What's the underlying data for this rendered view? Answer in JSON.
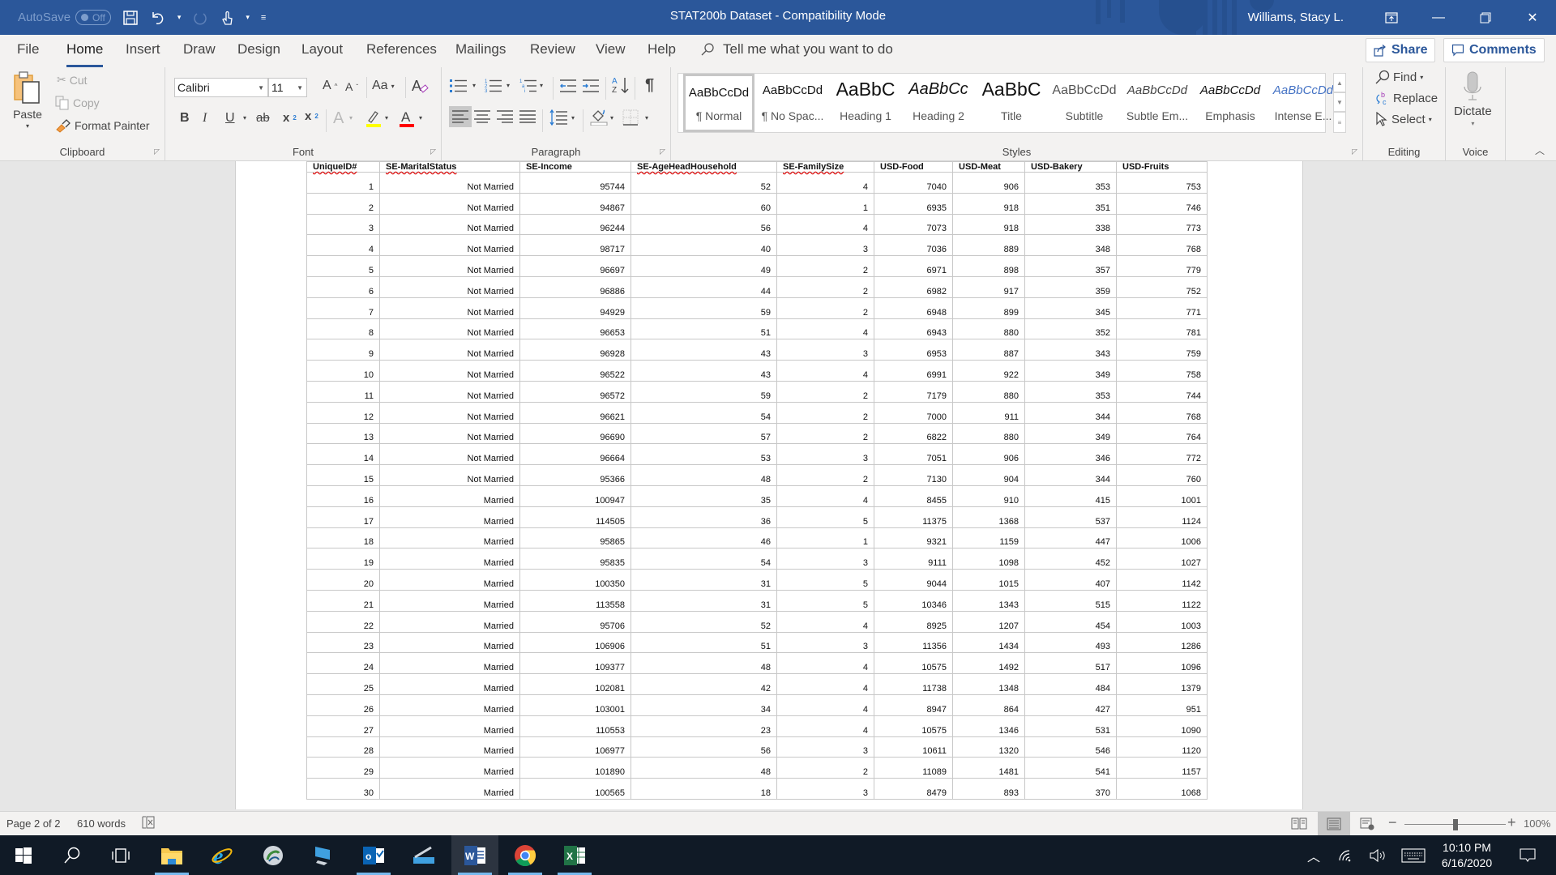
{
  "titlebar": {
    "autosave_label": "AutoSave",
    "autosave_state": "Off",
    "doc_title": "STAT200b Dataset  -  Compatibility Mode",
    "user_name": "Williams, Stacy L.",
    "qat": [
      "save-icon",
      "undo-icon",
      "redo-icon",
      "touch-mode-icon",
      "customize-qat-icon"
    ],
    "window_buttons": [
      "ribbon-display-options-icon",
      "minimize-icon",
      "restore-icon",
      "close-icon"
    ]
  },
  "tabs": [
    {
      "label": "File",
      "active": false
    },
    {
      "label": "Home",
      "active": true
    },
    {
      "label": "Insert",
      "active": false
    },
    {
      "label": "Draw",
      "active": false
    },
    {
      "label": "Design",
      "active": false
    },
    {
      "label": "Layout",
      "active": false
    },
    {
      "label": "References",
      "active": false
    },
    {
      "label": "Mailings",
      "active": false
    },
    {
      "label": "Review",
      "active": false
    },
    {
      "label": "View",
      "active": false
    },
    {
      "label": "Help",
      "active": false
    }
  ],
  "tellme": {
    "placeholder": "Tell me what you want to do"
  },
  "share_label": "Share",
  "comments_label": "Comments",
  "ribbon": {
    "clipboard": {
      "label": "Clipboard",
      "paste": "Paste",
      "cut": "Cut",
      "copy": "Copy",
      "format_painter": "Format Painter"
    },
    "font": {
      "label": "Font",
      "font_name": "Calibri",
      "font_size": "11",
      "change_case": "Aa"
    },
    "paragraph": {
      "label": "Paragraph"
    },
    "styles": {
      "label": "Styles",
      "items": [
        {
          "sample": "AaBbCcDd",
          "name": "¶ Normal",
          "selected": true
        },
        {
          "sample": "AaBbCcDd",
          "name": "¶ No Spac...",
          "selected": false
        },
        {
          "sample": "AaBbC",
          "name": "Heading 1",
          "selected": false
        },
        {
          "sample": "AaBbCc",
          "name": "Heading 2",
          "selected": false
        },
        {
          "sample": "AaBbC",
          "name": "Title",
          "selected": false
        },
        {
          "sample": "AaBbCcDd",
          "name": "Subtitle",
          "selected": false
        },
        {
          "sample": "AaBbCcDd",
          "name": "Subtle Em...",
          "selected": false
        },
        {
          "sample": "AaBbCcDd",
          "name": "Emphasis",
          "selected": false
        },
        {
          "sample": "AaBbCcDd",
          "name": "Intense E...",
          "selected": false
        }
      ]
    },
    "editing": {
      "label": "Editing",
      "find": "Find",
      "replace": "Replace",
      "select": "Select"
    },
    "voice": {
      "label": "Voice",
      "dictate": "Dictate"
    }
  },
  "table": {
    "headers": [
      "UniqueID#",
      "SE-MaritalStatus",
      "SE-Income",
      "SE-AgeHeadHousehold",
      "SE-FamilySize",
      "USD-Food",
      "USD-Meat",
      "USD-Bakery",
      "USD-Fruits"
    ],
    "rows": [
      [
        "1",
        "Not Married",
        "95744",
        "52",
        "4",
        "7040",
        "906",
        "353",
        "753"
      ],
      [
        "2",
        "Not Married",
        "94867",
        "60",
        "1",
        "6935",
        "918",
        "351",
        "746"
      ],
      [
        "3",
        "Not Married",
        "96244",
        "56",
        "4",
        "7073",
        "918",
        "338",
        "773"
      ],
      [
        "4",
        "Not Married",
        "98717",
        "40",
        "3",
        "7036",
        "889",
        "348",
        "768"
      ],
      [
        "5",
        "Not Married",
        "96697",
        "49",
        "2",
        "6971",
        "898",
        "357",
        "779"
      ],
      [
        "6",
        "Not Married",
        "96886",
        "44",
        "2",
        "6982",
        "917",
        "359",
        "752"
      ],
      [
        "7",
        "Not Married",
        "94929",
        "59",
        "2",
        "6948",
        "899",
        "345",
        "771"
      ],
      [
        "8",
        "Not Married",
        "96653",
        "51",
        "4",
        "6943",
        "880",
        "352",
        "781"
      ],
      [
        "9",
        "Not Married",
        "96928",
        "43",
        "3",
        "6953",
        "887",
        "343",
        "759"
      ],
      [
        "10",
        "Not Married",
        "96522",
        "43",
        "4",
        "6991",
        "922",
        "349",
        "758"
      ],
      [
        "11",
        "Not Married",
        "96572",
        "59",
        "2",
        "7179",
        "880",
        "353",
        "744"
      ],
      [
        "12",
        "Not Married",
        "96621",
        "54",
        "2",
        "7000",
        "911",
        "344",
        "768"
      ],
      [
        "13",
        "Not Married",
        "96690",
        "57",
        "2",
        "6822",
        "880",
        "349",
        "764"
      ],
      [
        "14",
        "Not Married",
        "96664",
        "53",
        "3",
        "7051",
        "906",
        "346",
        "772"
      ],
      [
        "15",
        "Not Married",
        "95366",
        "48",
        "2",
        "7130",
        "904",
        "344",
        "760"
      ],
      [
        "16",
        "Married",
        "100947",
        "35",
        "4",
        "8455",
        "910",
        "415",
        "1001"
      ],
      [
        "17",
        "Married",
        "114505",
        "36",
        "5",
        "11375",
        "1368",
        "537",
        "1124"
      ],
      [
        "18",
        "Married",
        "95865",
        "46",
        "1",
        "9321",
        "1159",
        "447",
        "1006"
      ],
      [
        "19",
        "Married",
        "95835",
        "54",
        "3",
        "9111",
        "1098",
        "452",
        "1027"
      ],
      [
        "20",
        "Married",
        "100350",
        "31",
        "5",
        "9044",
        "1015",
        "407",
        "1142"
      ],
      [
        "21",
        "Married",
        "113558",
        "31",
        "5",
        "10346",
        "1343",
        "515",
        "1122"
      ],
      [
        "22",
        "Married",
        "95706",
        "52",
        "4",
        "8925",
        "1207",
        "454",
        "1003"
      ],
      [
        "23",
        "Married",
        "106906",
        "51",
        "3",
        "11356",
        "1434",
        "493",
        "1286"
      ],
      [
        "24",
        "Married",
        "109377",
        "48",
        "4",
        "10575",
        "1492",
        "517",
        "1096"
      ],
      [
        "25",
        "Married",
        "102081",
        "42",
        "4",
        "11738",
        "1348",
        "484",
        "1379"
      ],
      [
        "26",
        "Married",
        "103001",
        "34",
        "4",
        "8947",
        "864",
        "427",
        "951"
      ],
      [
        "27",
        "Married",
        "110553",
        "23",
        "4",
        "10575",
        "1346",
        "531",
        "1090"
      ],
      [
        "28",
        "Married",
        "106977",
        "56",
        "3",
        "10611",
        "1320",
        "546",
        "1120"
      ],
      [
        "29",
        "Married",
        "101890",
        "48",
        "2",
        "11089",
        "1481",
        "541",
        "1157"
      ],
      [
        "30",
        "Married",
        "100565",
        "18",
        "3",
        "8479",
        "893",
        "370",
        "1068"
      ]
    ]
  },
  "statusbar": {
    "page": "Page 2 of 2",
    "words": "610 words",
    "zoom_level": "100%",
    "zoom_percent": 100
  },
  "taskbar": {
    "apps": [
      "start-icon",
      "search-icon",
      "task-view-icon",
      "file-explorer-icon",
      "internet-explorer-icon",
      "cisco-anyconnect-icon",
      "remote-desktop-icon",
      "outlook-icon",
      "scanner-icon",
      "word-icon",
      "chrome-icon",
      "excel-icon"
    ],
    "time": "10:10 PM",
    "date": "6/16/2020"
  },
  "colors": {
    "brand": "#2b579a",
    "taskbar": "#101a26"
  }
}
